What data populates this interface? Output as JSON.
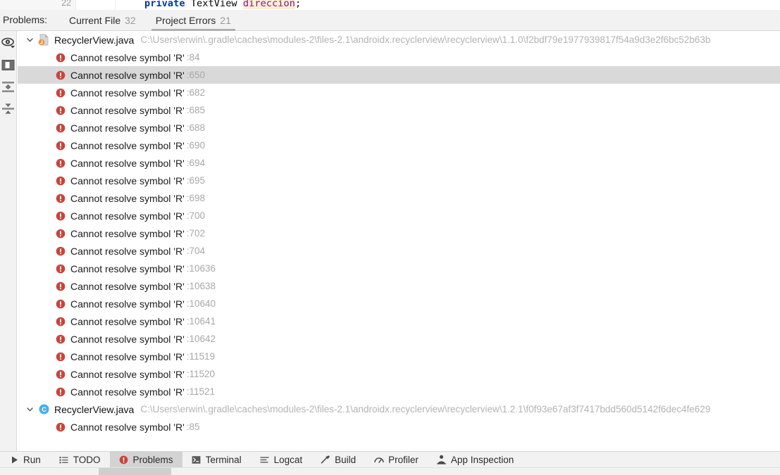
{
  "editor_strip": {
    "line_number": "22",
    "code": {
      "keyword": "private",
      "type": "TextView",
      "field": "direccion",
      "punct": ";"
    }
  },
  "problems_panel": {
    "label": "Problems:",
    "tabs": [
      {
        "label": "Current File",
        "count": "32",
        "active": false,
        "icon": "tab-current-file"
      },
      {
        "label": "Project Errors",
        "count": "21",
        "active": true,
        "icon": "tab-project-errors"
      }
    ]
  },
  "side_toolbar": {
    "buttons": [
      {
        "name": "view-options-icon",
        "tooltip": "View Options"
      },
      {
        "name": "preview-panel-icon",
        "tooltip": "Open Preview"
      },
      {
        "name": "expand-all-icon",
        "tooltip": "Expand All"
      },
      {
        "name": "collapse-all-icon",
        "tooltip": "Collapse All"
      }
    ]
  },
  "tree": {
    "groups": [
      {
        "icon": "java-file-icon",
        "expanded": true,
        "name": "RecyclerView.java",
        "path": "C:\\Users\\erwin\\.gradle\\caches\\modules-2\\files-2.1\\androidx.recyclerview\\recyclerview\\1.1.0\\f2bdf79e1977939817f54a9d3e2f6bc52b63b",
        "problems": [
          {
            "message": "Cannot resolve symbol 'R'",
            "line": ":84",
            "selected": false
          },
          {
            "message": "Cannot resolve symbol 'R'",
            "line": ":650",
            "selected": true
          },
          {
            "message": "Cannot resolve symbol 'R'",
            "line": ":682",
            "selected": false
          },
          {
            "message": "Cannot resolve symbol 'R'",
            "line": ":685",
            "selected": false
          },
          {
            "message": "Cannot resolve symbol 'R'",
            "line": ":688",
            "selected": false
          },
          {
            "message": "Cannot resolve symbol 'R'",
            "line": ":690",
            "selected": false
          },
          {
            "message": "Cannot resolve symbol 'R'",
            "line": ":694",
            "selected": false
          },
          {
            "message": "Cannot resolve symbol 'R'",
            "line": ":695",
            "selected": false
          },
          {
            "message": "Cannot resolve symbol 'R'",
            "line": ":698",
            "selected": false
          },
          {
            "message": "Cannot resolve symbol 'R'",
            "line": ":700",
            "selected": false
          },
          {
            "message": "Cannot resolve symbol 'R'",
            "line": ":702",
            "selected": false
          },
          {
            "message": "Cannot resolve symbol 'R'",
            "line": ":704",
            "selected": false
          },
          {
            "message": "Cannot resolve symbol 'R'",
            "line": ":10636",
            "selected": false
          },
          {
            "message": "Cannot resolve symbol 'R'",
            "line": ":10638",
            "selected": false
          },
          {
            "message": "Cannot resolve symbol 'R'",
            "line": ":10640",
            "selected": false
          },
          {
            "message": "Cannot resolve symbol 'R'",
            "line": ":10641",
            "selected": false
          },
          {
            "message": "Cannot resolve symbol 'R'",
            "line": ":10642",
            "selected": false
          },
          {
            "message": "Cannot resolve symbol 'R'",
            "line": ":11519",
            "selected": false
          },
          {
            "message": "Cannot resolve symbol 'R'",
            "line": ":11520",
            "selected": false
          },
          {
            "message": "Cannot resolve symbol 'R'",
            "line": ":11521",
            "selected": false
          }
        ]
      },
      {
        "icon": "class-icon",
        "expanded": true,
        "name": "RecyclerView.java",
        "path": "C:\\Users\\erwin\\.gradle\\caches\\modules-2\\files-2.1\\androidx.recyclerview\\recyclerview\\1.2.1\\f0f93e67af3f7417bdd560d5142f6dec4fe629",
        "problems": [
          {
            "message": "Cannot resolve symbol 'R'",
            "line": ":85",
            "selected": false
          }
        ]
      }
    ]
  },
  "bottom_bar": {
    "items": [
      {
        "label": "Run",
        "icon": "run-icon",
        "active": false
      },
      {
        "label": "TODO",
        "icon": "todo-icon",
        "active": false
      },
      {
        "label": "Problems",
        "icon": "problems-error-icon",
        "active": true
      },
      {
        "label": "Terminal",
        "icon": "terminal-icon",
        "active": false
      },
      {
        "label": "Logcat",
        "icon": "logcat-icon",
        "active": false
      },
      {
        "label": "Build",
        "icon": "build-hammer-icon",
        "active": false
      },
      {
        "label": "Profiler",
        "icon": "profiler-icon",
        "active": false
      },
      {
        "label": "App Inspection",
        "icon": "app-inspection-icon",
        "active": false
      }
    ]
  },
  "colors": {
    "error_red": "#c9443b",
    "panel_bg": "#f2f2f2",
    "selection_gray": "#d9d9d9",
    "path_gray": "#b3b3b3",
    "keyword_blue": "#0033b3",
    "field_purple": "#871094",
    "class_icon_blue": "#4aa8e0"
  }
}
